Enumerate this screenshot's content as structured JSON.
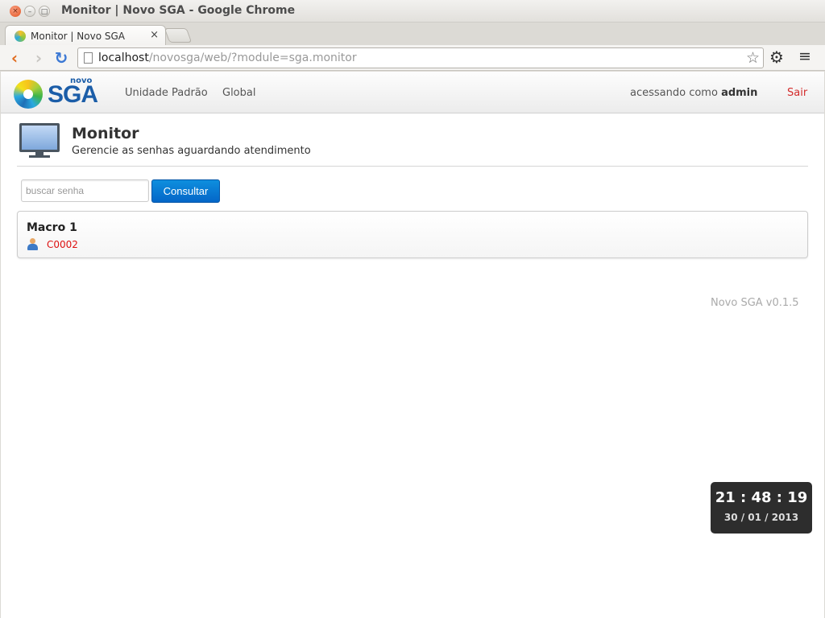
{
  "window": {
    "title": "Monitor | Novo SGA - Google Chrome"
  },
  "tab": {
    "title": "Monitor | Novo SGA",
    "close": "×"
  },
  "address_bar": {
    "host": "localhost",
    "path": "/novosga/web/?module=sga.monitor"
  },
  "icons": {
    "back": "back-arrow-icon",
    "forward": "forward-arrow-icon",
    "reload": "reload-icon",
    "star": "bookmark-star-icon",
    "settings": "gear-icon",
    "menu": "hamburger-menu-icon",
    "monitor": "computer-monitor-icon",
    "ticket": "person-icon"
  },
  "navbar": {
    "logo_small": "novo",
    "logo_text": "SGA",
    "links": [
      "Unidade Padrão",
      "Global"
    ],
    "user_prefix": "acessando como",
    "user_name": "admin",
    "logout": "Sair"
  },
  "page": {
    "title": "Monitor",
    "subtitle": "Gerencie as senhas aguardando atendimento"
  },
  "search": {
    "placeholder": "buscar senha",
    "button": "Consultar"
  },
  "services": [
    {
      "name": "Macro 1",
      "tickets": [
        "C0002"
      ]
    }
  ],
  "footer": {
    "version": "Novo SGA v0.1.5"
  },
  "clock": {
    "time": "21 : 48 : 19",
    "date": "30 / 01 / 2013"
  },
  "colors": {
    "accent": "#0466c8",
    "logout": "#d32b2b",
    "ticket": "#dd1111",
    "clock_bg": "#2d2d2d"
  }
}
